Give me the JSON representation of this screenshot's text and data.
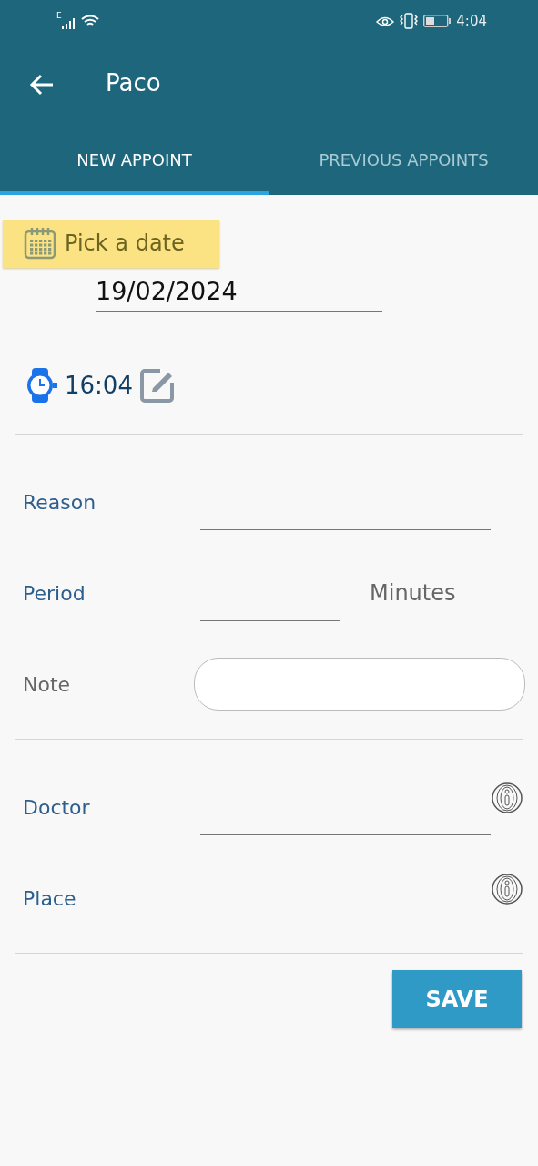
{
  "status_bar": {
    "network": "E",
    "time": "4:04"
  },
  "toolbar": {
    "title": "Paco"
  },
  "tabs": [
    {
      "label": "NEW APPOINT",
      "selected": true
    },
    {
      "label": "PREVIOUS APPOINTS",
      "selected": false
    }
  ],
  "date": {
    "button": "Pick a date",
    "value": "19/02/2024"
  },
  "time": {
    "value": "16:04"
  },
  "sections": [
    {
      "fields": [
        {
          "kind": "line",
          "label": "Reason"
        },
        {
          "kind": "short",
          "label": "Period",
          "suffix": "Minutes"
        },
        {
          "kind": "box",
          "label": "Note"
        }
      ]
    },
    {
      "fields": [
        {
          "kind": "info",
          "label": "Doctor"
        },
        {
          "kind": "info",
          "label": "Place"
        }
      ]
    }
  ],
  "save_button": "SAVE"
}
